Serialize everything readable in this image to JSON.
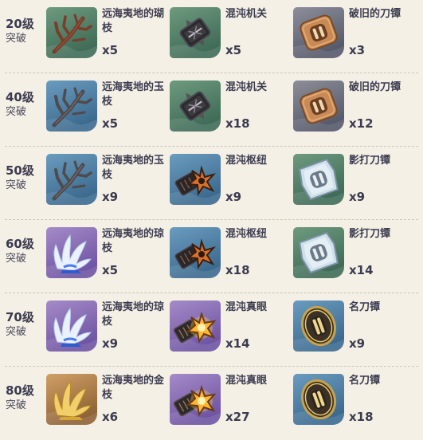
{
  "colors": {
    "rarity_green": "#4e7d65",
    "rarity_blue": "#4a7fa3",
    "rarity_purple": "#8e72b8",
    "rarity_gold": "#b98a4a",
    "page_background": "#f5f0e6"
  },
  "rows": [
    {
      "level": "20级",
      "label": "突破",
      "items": [
        {
          "name": "远海夷地的瑚枝",
          "qty": "x5",
          "icon": "coral-branch-icon",
          "rarity": "green"
        },
        {
          "name": "混沌机关",
          "qty": "x5",
          "icon": "chaos-device-icon",
          "rarity": "green"
        },
        {
          "name": "破旧的刀镡",
          "qty": "x3",
          "icon": "old-handguard-icon",
          "rarity": "gray"
        }
      ]
    },
    {
      "level": "40级",
      "label": "突破",
      "items": [
        {
          "name": "远海夷地的玉枝",
          "qty": "x5",
          "icon": "jade-branch-icon",
          "rarity": "blue"
        },
        {
          "name": "混沌机关",
          "qty": "x18",
          "icon": "chaos-device-icon",
          "rarity": "green"
        },
        {
          "name": "破旧的刀镡",
          "qty": "x12",
          "icon": "old-handguard-icon",
          "rarity": "gray"
        }
      ]
    },
    {
      "level": "50级",
      "label": "突破",
      "items": [
        {
          "name": "远海夷地的玉枝",
          "qty": "x9",
          "icon": "jade-branch-icon",
          "rarity": "blue"
        },
        {
          "name": "混沌枢纽",
          "qty": "x9",
          "icon": "chaos-circuit-icon",
          "rarity": "blue"
        },
        {
          "name": "影打刀镡",
          "qty": "x9",
          "icon": "kageuchi-handguard-icon",
          "rarity": "green"
        }
      ]
    },
    {
      "level": "60级",
      "label": "突破",
      "items": [
        {
          "name": "远海夷地的琼枝",
          "qty": "x5",
          "icon": "jeweled-branch-icon",
          "rarity": "purple"
        },
        {
          "name": "混沌枢纽",
          "qty": "x18",
          "icon": "chaos-circuit-icon",
          "rarity": "blue"
        },
        {
          "name": "影打刀镡",
          "qty": "x14",
          "icon": "kageuchi-handguard-icon",
          "rarity": "green"
        }
      ]
    },
    {
      "level": "70级",
      "label": "突破",
      "items": [
        {
          "name": "远海夷地的琼枝",
          "qty": "x9",
          "icon": "jeweled-branch-icon",
          "rarity": "purple"
        },
        {
          "name": "混沌真眼",
          "qty": "x14",
          "icon": "chaos-core-icon",
          "rarity": "purple"
        },
        {
          "name": "名刀镡",
          "qty": "x9",
          "icon": "famous-handguard-icon",
          "rarity": "blue"
        }
      ]
    },
    {
      "level": "80级",
      "label": "突破",
      "items": [
        {
          "name": "远海夷地的金枝",
          "qty": "x6",
          "icon": "golden-branch-icon",
          "rarity": "gold"
        },
        {
          "name": "混沌真眼",
          "qty": "x27",
          "icon": "chaos-core-icon",
          "rarity": "purple"
        },
        {
          "name": "名刀镡",
          "qty": "x18",
          "icon": "famous-handguard-icon",
          "rarity": "blue"
        }
      ]
    }
  ]
}
